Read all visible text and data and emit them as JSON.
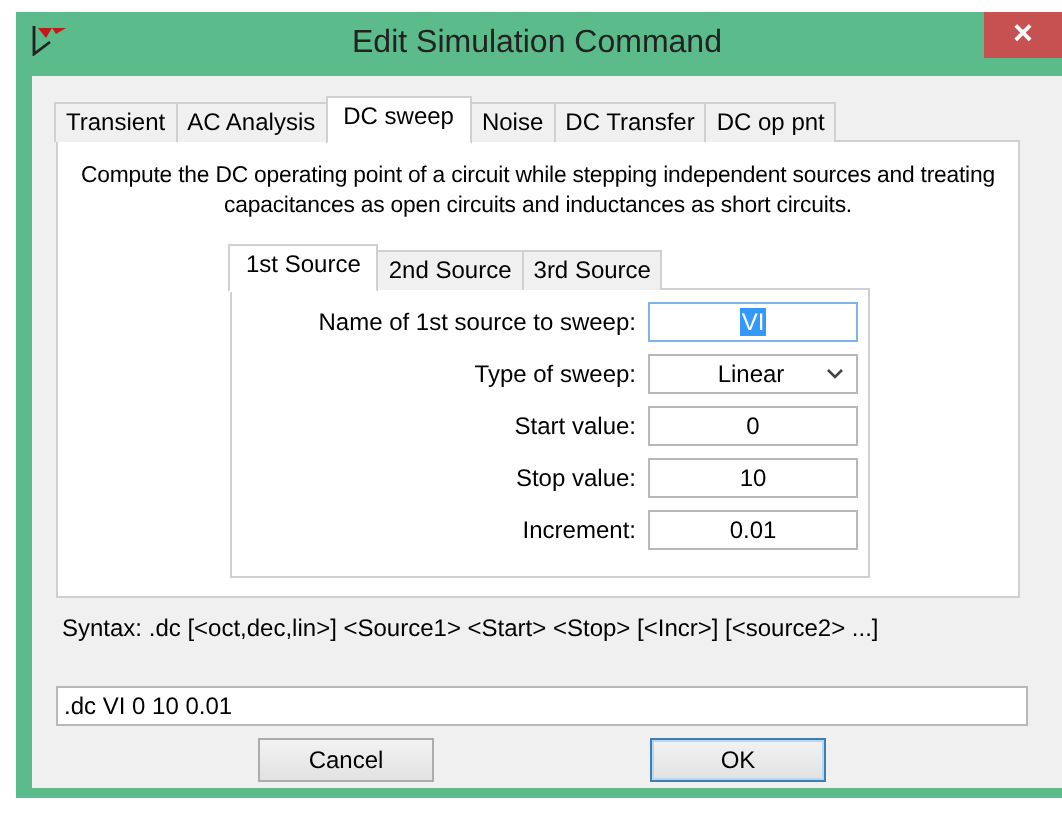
{
  "window": {
    "title": "Edit Simulation Command",
    "close": "×"
  },
  "tabs": [
    {
      "label": "Transient",
      "selected": false
    },
    {
      "label": "AC Analysis",
      "selected": false
    },
    {
      "label": "DC sweep",
      "selected": true
    },
    {
      "label": "Noise",
      "selected": false
    },
    {
      "label": "DC Transfer",
      "selected": false
    },
    {
      "label": "DC op pnt",
      "selected": false
    }
  ],
  "description": "Compute the DC operating point of a circuit while stepping independent sources and treating capacitances as open circuits and inductances as short circuits.",
  "source_tabs": [
    {
      "label": "1st Source",
      "selected": true
    },
    {
      "label": "2nd Source",
      "selected": false
    },
    {
      "label": "3rd Source",
      "selected": false
    }
  ],
  "fields": [
    {
      "label": "Name of 1st source to sweep:",
      "kind": "text",
      "value": "VI",
      "highlighted": true
    },
    {
      "label": "Type of sweep:",
      "kind": "select",
      "value": "Linear"
    },
    {
      "label": "Start value:",
      "kind": "text",
      "value": "0",
      "highlighted": false
    },
    {
      "label": "Stop value:",
      "kind": "text",
      "value": "10",
      "highlighted": false
    },
    {
      "label": "Increment:",
      "kind": "text",
      "value": "0.01",
      "highlighted": false
    }
  ],
  "syntax": "Syntax:  .dc [<oct,dec,lin>] <Source1> <Start> <Stop> [<Incr>] [<source2> ...]",
  "command": ".dc VI 0 10 0.01",
  "buttons": [
    {
      "label": "Cancel",
      "default": false
    },
    {
      "label": "OK",
      "default": true
    }
  ]
}
